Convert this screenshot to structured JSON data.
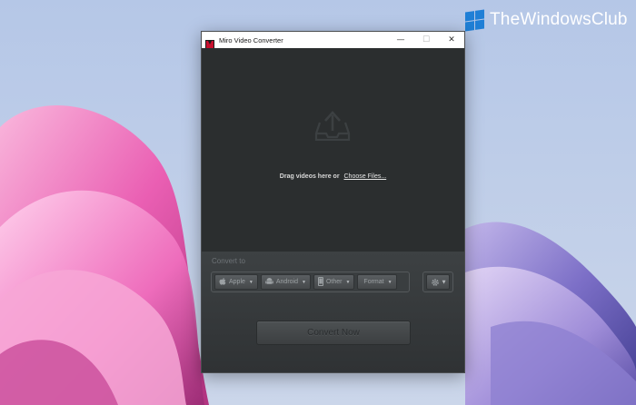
{
  "watermark": {
    "text": "TheWindowsClub"
  },
  "window": {
    "title": "Miro Video Converter",
    "controls": {
      "minimize": "—",
      "maximize": "☐",
      "close": "✕"
    }
  },
  "dropzone": {
    "text": "Drag videos here or",
    "link": "Choose Files..."
  },
  "panel": {
    "convert_label": "Convert to",
    "devices": [
      {
        "label": "Apple",
        "icon": "apple-icon"
      },
      {
        "label": "Android",
        "icon": "android-icon"
      },
      {
        "label": "Other",
        "icon": "phone-icon"
      },
      {
        "label": "Format",
        "icon": ""
      }
    ],
    "settings_icon": "gear-icon",
    "convert_button": "Convert Now"
  },
  "colors": {
    "window_bg": "#2b2e2f",
    "panel_bg": "#3d4143",
    "accent_logo": "#c8102e",
    "watermark_blue": "#1f7fd6"
  }
}
